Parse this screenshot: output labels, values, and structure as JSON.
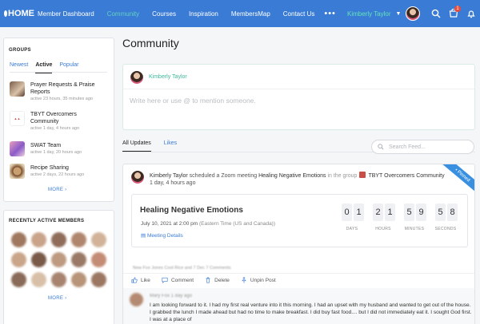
{
  "nav": {
    "logo": "HOME",
    "items": [
      {
        "label": "Member Dashboard",
        "active": false
      },
      {
        "label": "Community",
        "active": true
      },
      {
        "label": "Courses",
        "active": false
      },
      {
        "label": "Inspiration",
        "active": false
      },
      {
        "label": "MembersMap",
        "active": false
      },
      {
        "label": "Contact Us",
        "active": false
      }
    ],
    "more": "•••",
    "user_name": "Kimberly Taylor",
    "cart_count": "1",
    "icons": [
      "search-icon",
      "cart-icon",
      "bell-icon"
    ]
  },
  "sidebar": {
    "groups_title": "GROUPS",
    "tabs": [
      {
        "label": "Newest",
        "active": false
      },
      {
        "label": "Active",
        "active": true
      },
      {
        "label": "Popular",
        "active": false
      }
    ],
    "groups": [
      {
        "name": "Prayer Requests & Praise Reports",
        "meta": "active 23 hours, 35 minutes ago"
      },
      {
        "name": "TBYT Overcomers Community",
        "meta": "active 1 day, 4 hours ago"
      },
      {
        "name": "SWAT Team",
        "meta": "active 1 day, 20 hours ago"
      },
      {
        "name": "Recipe Sharing",
        "meta": "active 2 days, 22 hours ago"
      }
    ],
    "more": "MORE",
    "members_title": "RECENTLY ACTIVE MEMBERS",
    "members_more": "MORE"
  },
  "main": {
    "title": "Community",
    "composer": {
      "author": "Kimberly Taylor",
      "placeholder": "Write here or use @ to mention someone."
    },
    "tabs": [
      {
        "label": "All Updates",
        "active": true
      },
      {
        "label": "Likes",
        "active": false
      }
    ],
    "search_placeholder": "Search Feed..."
  },
  "post": {
    "pinned": "Pinned",
    "actor": "Kimberly Taylor",
    "action": "scheduled a Zoom meeting",
    "meeting_link": "Healing Negative Emotions",
    "in_the_group": "in the group",
    "group": "TBYT Overcomers Community",
    "time": "1 day, 4 hours ago",
    "meeting": {
      "title": "Healing Negative Emotions",
      "date": "July 10, 2021 at 2:00 pm",
      "timezone": "(Eastern Time (US and Canada))",
      "details": "Meeting Details",
      "countdown": {
        "days": [
          "0",
          "1"
        ],
        "hours": [
          "2",
          "1"
        ],
        "minutes": [
          "5",
          "9"
        ],
        "seconds": [
          "5",
          "8"
        ],
        "labels": {
          "days": "DAYS",
          "hours": "HOURS",
          "minutes": "MINUTES",
          "seconds": "SECONDS"
        }
      }
    },
    "blurred_line": "New Fox Jones Cool Rice and 7 Dec 7 Comments",
    "actions": {
      "like": "Like",
      "comment": "Comment",
      "delete": "Delete",
      "unpin": "Unpin Post"
    },
    "comment": {
      "author": "Mary Fox 1 day ago",
      "text": "I am looking forward to it. I had my first real venture into it this morning. I had an upset with my husband and wanted to get out of the house. I grabbed the lunch I made ahead but had no time to make breakfast. I did buy fast food.... but I did not immediately eat it. I sought God first. I was at a place of"
    }
  },
  "colors": {
    "accent": "#3a7bd5",
    "nav_active": "#63d0c0",
    "user_green": "#63e5b8",
    "pinned": "#3a90e0"
  }
}
